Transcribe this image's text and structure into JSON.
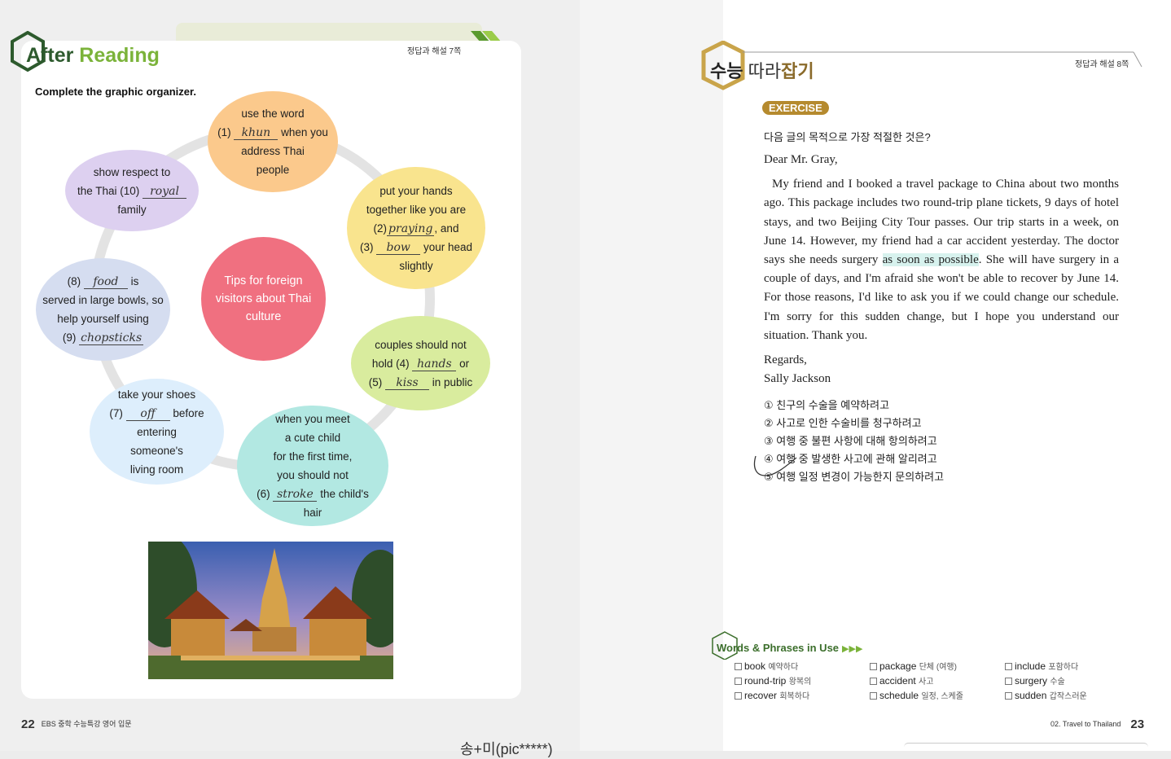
{
  "left_page": {
    "title_word1": "After",
    "title_word2": "Reading",
    "answer_ref": "정답과 해설 7쪽",
    "instruction": "Complete the graphic organizer.",
    "center": "Tips for foreign visitors about Thai culture",
    "bubbles": {
      "b1": {
        "l1": "use the word",
        "num": "(1)",
        "ans": "khun",
        "l2b": "when you",
        "l3": "address Thai",
        "l4": "people"
      },
      "b2": {
        "l1": "put your hands",
        "l2": "together like you are",
        "num2": "(2)",
        "ans2": "praying",
        "l3b": ", and",
        "num3": "(3)",
        "ans3": "bow",
        "l4b": "your head",
        "l5": "slightly"
      },
      "b3": {
        "l1": "couples should not",
        "l2a": "hold",
        "num4": "(4)",
        "ans4": "hands",
        "l2b": "or",
        "num5": "(5)",
        "ans5": "kiss",
        "l3b": "in public"
      },
      "b4": {
        "l1": "when you meet",
        "l2": "a cute child",
        "l3": "for the first time,",
        "l4": "you should not",
        "num6": "(6)",
        "ans6": "stroke",
        "l5b": "the child's",
        "l6": "hair"
      },
      "b5": {
        "l1": "take your shoes",
        "num7": "(7)",
        "ans7": "off",
        "l2b": "before",
        "l3": "entering",
        "l4": "someone's",
        "l5": "living room"
      },
      "b6": {
        "num8": "(8)",
        "ans8": "food",
        "l1b": "is",
        "l2": "served in large bowls, so",
        "l3": "help yourself using",
        "num9": "(9)",
        "ans9": "chopsticks"
      },
      "b7": {
        "l1": "show respect to",
        "l2a": "the Thai",
        "num10": "(10)",
        "ans10": "royal",
        "l3": "family"
      }
    },
    "footer_page": "22",
    "footer_text": "EBS 중학 수능특강 영어 입문",
    "stamp": "송+미(pic*****)"
  },
  "right_page": {
    "title_a": "수능",
    "title_b": "따라",
    "title_c": "잡기",
    "answer_ref": "정답과 해설 8쪽",
    "exercise_label": "EXERCISE",
    "question": "다음 글의 목적으로 가장 적절한 것은?",
    "salutation": "Dear Mr. Gray,",
    "body_pre": "My friend and I booked a travel package to China about two months ago. This package includes two round-trip plane tickets, 9 days of hotel stays, and two Beijing City Tour passes. Our trip starts in a week, on June 14. However, my friend had a car accident yesterday. The doctor says she needs surgery ",
    "body_highlight": "as soon as possible",
    "body_post": ". She will have surgery in a couple of days, and I'm afraid she won't be able to recover by June 14. For those reasons, I'd like to ask you if we could change our schedule. I'm sorry for this sudden change, but I hope you understand our situation. Thank you.",
    "closing": "Regards,",
    "signature": "Sally Jackson",
    "choices": [
      "① 친구의 수술을 예약하려고",
      "② 사고로 인한 수술비를 청구하려고",
      "③ 여행 중 불편 사항에 대해 항의하려고",
      "④ 여행 중 발생한 사고에 관해 알리려고",
      "⑤ 여행 일정 변경이 가능한지 문의하려고"
    ],
    "words_title": "Words & Phrases in Use",
    "vocab": [
      {
        "en": "book",
        "ko": "예약하다"
      },
      {
        "en": "package",
        "ko": "단체 (여행)"
      },
      {
        "en": "include",
        "ko": "포함하다"
      },
      {
        "en": "round-trip",
        "ko": "왕복의"
      },
      {
        "en": "accident",
        "ko": "사고"
      },
      {
        "en": "surgery",
        "ko": "수술"
      },
      {
        "en": "recover",
        "ko": "회복하다"
      },
      {
        "en": "schedule",
        "ko": "일정, 스케줄"
      },
      {
        "en": "sudden",
        "ko": "갑작스러운"
      }
    ],
    "footer_text": "02. Travel to Thailand",
    "footer_page": "23"
  },
  "colors": {
    "green_dark": "#2d5a2d",
    "green_light": "#7bb33a",
    "center_bubble": "#f07080",
    "exercise_badge": "#b58a2e",
    "highlight": "#d7f2ee"
  }
}
